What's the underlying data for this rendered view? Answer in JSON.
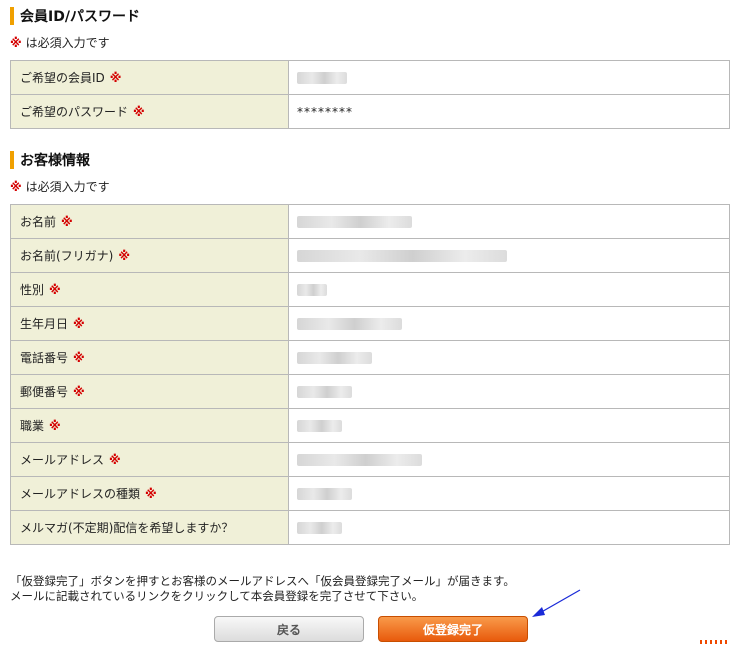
{
  "account_section": {
    "title": "会員ID/パスワード",
    "required_note": "は必須入力です",
    "required_mark": "※",
    "rows": [
      {
        "label": "ご希望の会員ID",
        "value": ""
      },
      {
        "label": "ご希望のパスワード",
        "value": "********"
      }
    ]
  },
  "customer_section": {
    "title": "お客様情報",
    "required_note": "は必須入力です",
    "required_mark": "※",
    "rows": [
      {
        "label": "お名前"
      },
      {
        "label": "お名前(フリガナ)"
      },
      {
        "label": "性別"
      },
      {
        "label": "生年月日"
      },
      {
        "label": "電話番号"
      },
      {
        "label": "郵便番号"
      },
      {
        "label": "職業"
      },
      {
        "label": "メールアドレス"
      },
      {
        "label": "メールアドレスの種類"
      },
      {
        "label": "メルマガ(不定期)配信を希望しますか？"
      }
    ]
  },
  "message": {
    "line1": "「仮登録完了」ボタンを押すとお客様のメールアドレスへ「仮会員登録完了メール」が届きます。",
    "line2": "メールに記載されているリンクをクリックして本会員登録を完了させて下さい。"
  },
  "buttons": {
    "back_label": "戻る",
    "submit_label": "仮登録完了"
  },
  "colors": {
    "accent_bar": "#f0a000",
    "required": "#d40000",
    "label_bg": "#f0f0d8",
    "submit": "#e85a0c",
    "arrow": "#1a2ad8"
  }
}
